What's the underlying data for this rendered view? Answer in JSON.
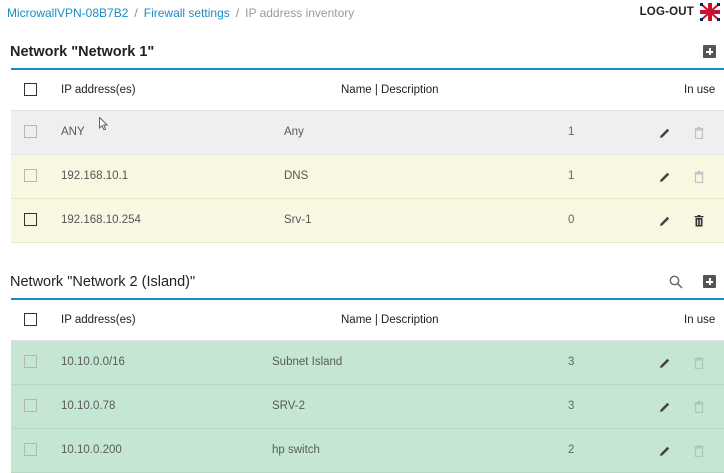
{
  "breadcrumb": {
    "device": "MicrowallVPN-08B7B2",
    "separator1": "/",
    "firewall": "Firewall settings",
    "separator2": "/",
    "current": "IP address inventory"
  },
  "header": {
    "logout_label": "LOG-OUT"
  },
  "networks": [
    {
      "title": "Network \"Network 1\"",
      "columns": {
        "ip": "IP address(es)",
        "name": "Name | Description",
        "in_use": "In use"
      },
      "rows": [
        {
          "ip": "ANY",
          "name": "Any",
          "in_use": "1",
          "delete_enabled": false
        },
        {
          "ip": "192.168.10.1",
          "name": "DNS",
          "in_use": "1",
          "delete_enabled": false
        },
        {
          "ip": "192.168.10.254",
          "name": "Srv-1",
          "in_use": "0",
          "delete_enabled": true
        }
      ]
    },
    {
      "title": "Network \"Network 2 (Island)\"",
      "columns": {
        "ip": "IP address(es)",
        "name": "Name | Description",
        "in_use": "In use"
      },
      "rows": [
        {
          "ip": "10.10.0.0/16",
          "name": "Subnet Island",
          "in_use": "3",
          "delete_enabled": false
        },
        {
          "ip": "10.10.0.78",
          "name": "SRV-2",
          "in_use": "3",
          "delete_enabled": false
        },
        {
          "ip": "10.10.0.200",
          "name": "hp switch",
          "in_use": "2",
          "delete_enabled": false
        }
      ]
    }
  ],
  "colors": {
    "accent": "#1b8bc6",
    "row_default": "#efefef",
    "row_yellow": "#f8f8e2",
    "row_green": "#c5e6d2"
  }
}
